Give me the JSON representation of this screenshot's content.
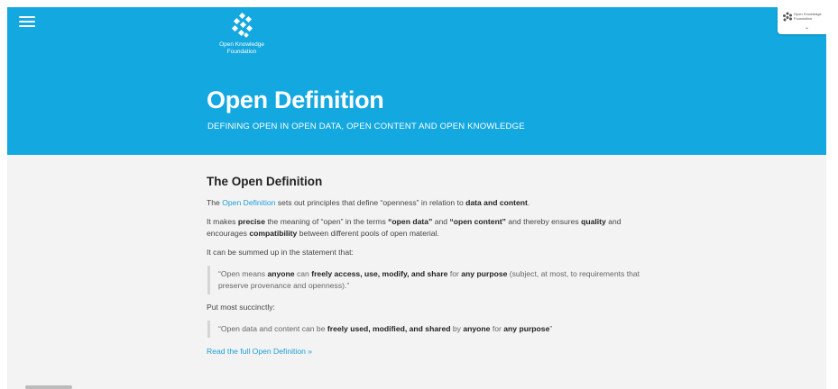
{
  "header": {
    "logo_text_line1": "Open Knowledge",
    "logo_text_line2": "Foundation",
    "badge_line1": "Open Knowledge",
    "badge_line2": "Foundation",
    "title": "Open Definition",
    "subtitle": "DEFINING OPEN IN OPEN DATA, OPEN CONTENT AND OPEN KNOWLEDGE",
    "brand_color": "#14a8e0",
    "menu_icon": "hamburger-icon"
  },
  "main": {
    "heading": "The Open Definition",
    "p1": {
      "a": "The ",
      "link": "Open Definition",
      "b": " sets out principles that define “openness” in relation to ",
      "bold": "data and content",
      "c": "."
    },
    "p2": {
      "a": "It makes ",
      "precise": "precise",
      "b": " the meaning of “open” in the terms ",
      "open_data": "“open data”",
      "c": " and ",
      "open_content": "“open content”",
      "d": " and thereby ensures ",
      "quality": "quality",
      "e": " and encourages ",
      "compatibility": "compatibility",
      "f": " between different pools of open material."
    },
    "p3": "It can be summed up in the statement that:",
    "quote1": {
      "a": "“Open means ",
      "anyone": "anyone",
      "b": " can ",
      "actions": "freely access, use, modify, and share",
      "c": " for ",
      "purpose": "any purpose",
      "d": " (subject, at most, to requirements that preserve provenance and openness).”"
    },
    "p4": "Put most succinctly:",
    "quote2": {
      "a": "“Open data and content can be ",
      "actions": "freely used, modified, and shared",
      "b": " by ",
      "anyone": "anyone",
      "c": " for ",
      "purpose": "any purpose",
      "d": "”"
    },
    "read_more": "Read the full Open Definition »",
    "link_color": "#1a9fd8"
  }
}
